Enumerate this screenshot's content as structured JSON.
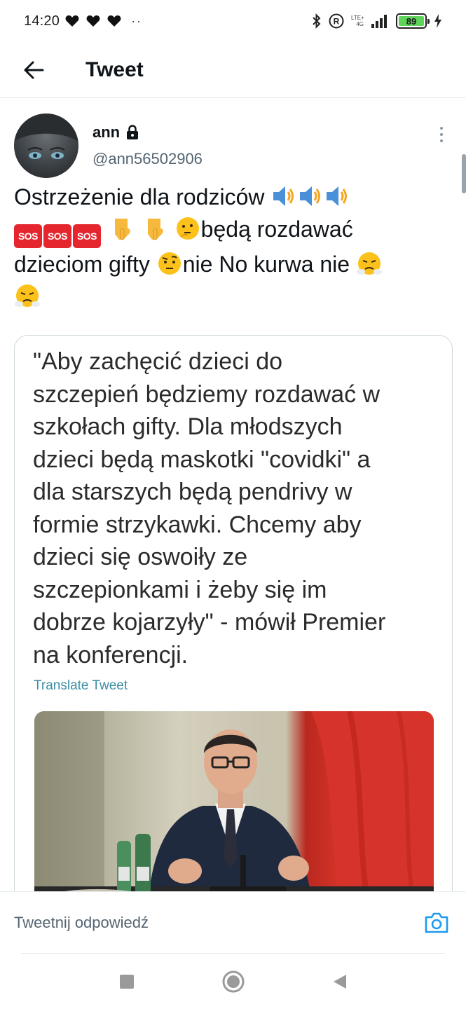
{
  "status_bar": {
    "time": "14:20",
    "dots": "··",
    "network": "LTE+",
    "network_sub": "4G",
    "battery": "89"
  },
  "header": {
    "title": "Tweet"
  },
  "tweet": {
    "author_name": "ann",
    "author_handle": "@ann56502906",
    "text": {
      "line1": "Ostrzeżenie dla rodziców",
      "line2": "będą rozdawać",
      "line3a": "dzieciom gifty",
      "line3b": "nie No kurwa nie",
      "sos": "SOS"
    }
  },
  "media": {
    "quote_lines": [
      "\"Aby zachęcić dzieci do",
      "szczepień będziemy rozdawać w",
      "szkołach gifty. Dla młodszych",
      "dzieci będą maskotki \"covidki\" a",
      "dla starszych będą pendrivy w",
      "formie strzykawki. Chcemy aby",
      "dzieci się oswoiły ze",
      "szczepionkami i żeby się im",
      "dobrze kojarzyły\" - mówił Premier",
      "na konferencji."
    ],
    "translate_label": "Translate Tweet"
  },
  "reply": {
    "placeholder": "Tweetnij odpowiedź"
  },
  "colors": {
    "link": "#3e8ea6",
    "secondary_text": "#536471",
    "camera": "#1d9bf0",
    "battery_fill": "#5fd35a",
    "flag_red": "#e0382b"
  }
}
